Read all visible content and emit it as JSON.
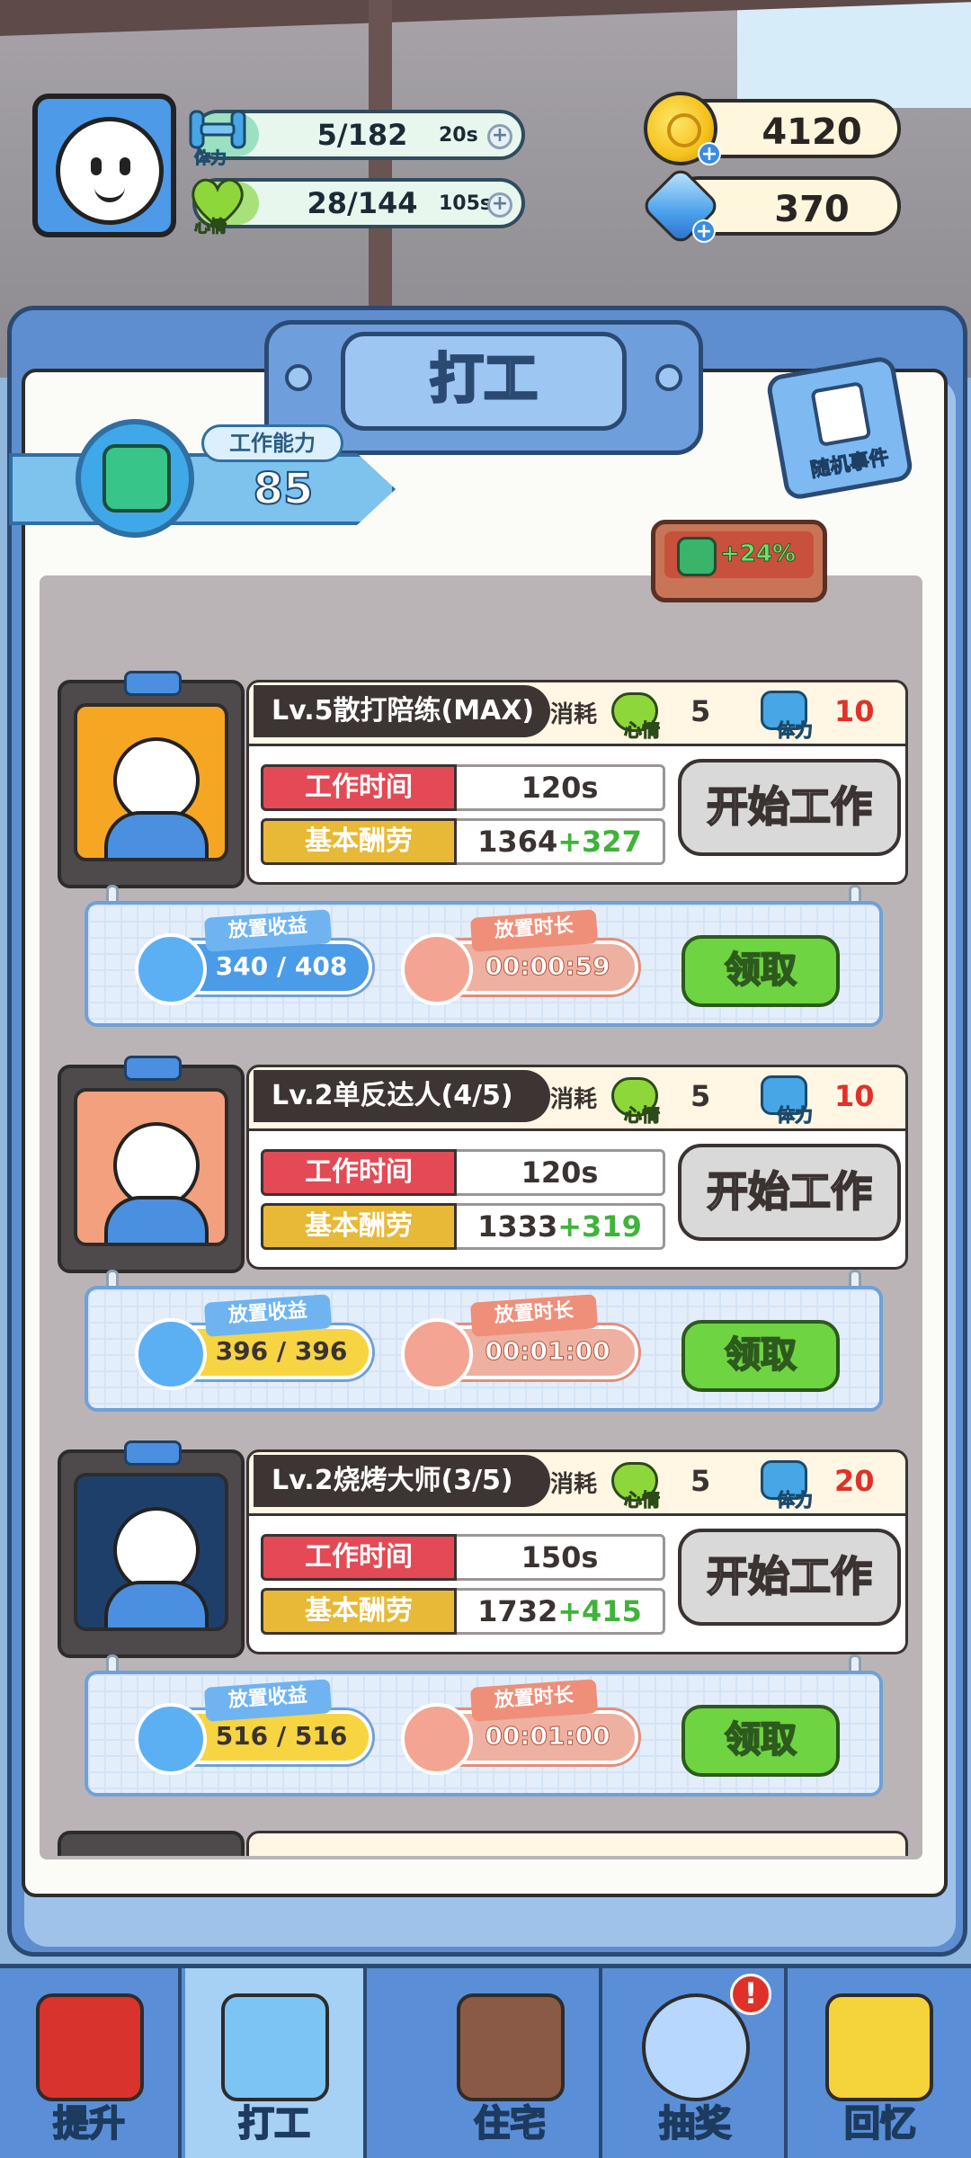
{
  "hud": {
    "stamina": {
      "label": "体力",
      "value": "5/182",
      "timer": "20s",
      "fill_ratio": 0.03
    },
    "mood": {
      "label": "心情",
      "value": "28/144",
      "timer": "105s",
      "fill_ratio": 0.19
    },
    "coins": "4120",
    "gems": "370"
  },
  "panel": {
    "title": "打工",
    "ability_label": "工作能力",
    "ability_value": "85",
    "random_event": "随机事件",
    "bonus": "+24%"
  },
  "jobs": [
    {
      "title": "Lv.5散打陪练(MAX)",
      "cost_label": "消耗",
      "mood_label": "心情",
      "mood_cost": "5",
      "stamina_label": "体力",
      "stamina_cost": "10",
      "time_label": "工作时间",
      "time_value": "120s",
      "pay_label": "基本酬劳",
      "pay_base": "1364",
      "pay_bonus": "+327",
      "start_label": "开始工作",
      "idle_earn_label": "放置收益",
      "idle_earn_value": "340 / 408",
      "idle_time_label": "放置时长",
      "idle_time_value": "00:00:59",
      "claim_label": "领取",
      "portrait_color": "#f5a623",
      "earn_full": false
    },
    {
      "title": "Lv.2单反达人(4/5)",
      "cost_label": "消耗",
      "mood_label": "心情",
      "mood_cost": "5",
      "stamina_label": "体力",
      "stamina_cost": "10",
      "time_label": "工作时间",
      "time_value": "120s",
      "pay_label": "基本酬劳",
      "pay_base": "1333",
      "pay_bonus": "+319",
      "start_label": "开始工作",
      "idle_earn_label": "放置收益",
      "idle_earn_value": "396 / 396",
      "idle_time_label": "放置时长",
      "idle_time_value": "00:01:00",
      "claim_label": "领取",
      "portrait_color": "#f3a07e",
      "earn_full": true
    },
    {
      "title": "Lv.2烧烤大师(3/5)",
      "cost_label": "消耗",
      "mood_label": "心情",
      "mood_cost": "5",
      "stamina_label": "体力",
      "stamina_cost": "20",
      "time_label": "工作时间",
      "time_value": "150s",
      "pay_label": "基本酬劳",
      "pay_base": "1732",
      "pay_bonus": "+415",
      "start_label": "开始工作",
      "idle_earn_label": "放置收益",
      "idle_earn_value": "516 / 516",
      "idle_time_label": "放置时长",
      "idle_time_value": "00:01:00",
      "claim_label": "领取",
      "portrait_color": "#1f3f6b",
      "earn_full": true
    }
  ],
  "nav": [
    {
      "label": "提升",
      "color": "#d8332c",
      "active": false,
      "badge": ""
    },
    {
      "label": "打工",
      "color": "#7cc4f4",
      "active": true,
      "badge": ""
    },
    {
      "label": "住宅",
      "color": "#8a5a46",
      "active": false,
      "badge": ""
    },
    {
      "label": "抽奖",
      "color": "#b7d7ff",
      "active": false,
      "badge": "!"
    },
    {
      "label": "回忆",
      "color": "#f5d33a",
      "active": false,
      "badge": ""
    }
  ],
  "colors": {
    "label_red": "#e34a55",
    "label_gold": "#e8b936",
    "bonus_green": "#3fb33a",
    "stamina_fill": "#9be0c0",
    "mood_fill": "#a8e07a"
  }
}
